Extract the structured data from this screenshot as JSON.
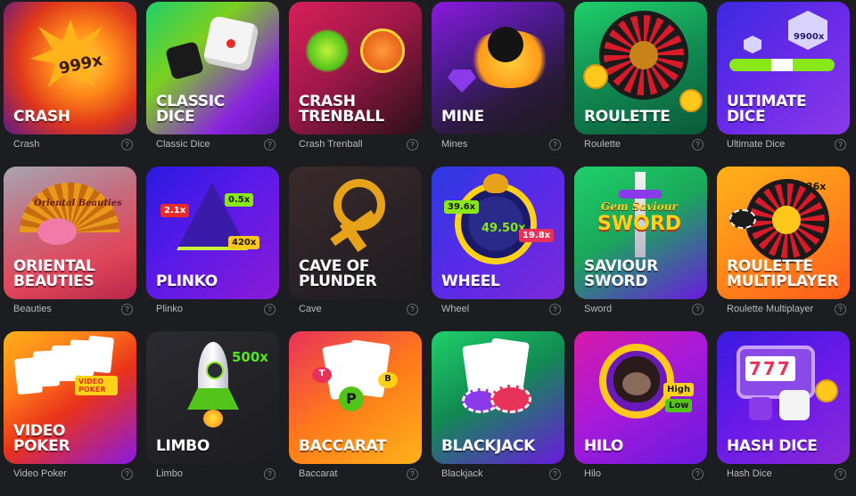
{
  "games": [
    {
      "title": "CRASH",
      "caption": "Crash",
      "badges": [
        "999x"
      ]
    },
    {
      "title": "CLASSIC\nDICE",
      "caption": "Classic Dice",
      "badges": []
    },
    {
      "title": "CRASH\nTRENBALL",
      "caption": "Crash Trenball",
      "badges": []
    },
    {
      "title": "MINE",
      "caption": "Mines",
      "badges": []
    },
    {
      "title": "ROULETTE",
      "caption": "Roulette",
      "badges": []
    },
    {
      "title": "ULTIMATE\nDICE",
      "caption": "Ultimate Dice",
      "badges": [
        "9900x"
      ]
    },
    {
      "title": "ORIENTAL\nBEAUTIES",
      "caption": "Beauties",
      "badges": [
        "Oriental Beauties"
      ]
    },
    {
      "title": "PLINKO",
      "caption": "Plinko",
      "badges": [
        "2.1x",
        "0.5x",
        "420x"
      ]
    },
    {
      "title": "CAVE OF\nPLUNDER",
      "caption": "Cave",
      "badges": []
    },
    {
      "title": "WHEEL",
      "caption": "Wheel",
      "badges": [
        "39.6x",
        "49.50x",
        "19.8x"
      ]
    },
    {
      "title": "SAVIOUR\nSWORD",
      "caption": "Sword",
      "badges": [
        "Gem Saviour",
        "SWORD"
      ]
    },
    {
      "title": "ROULETTE\nMULTIPLAYER",
      "caption": "Roulette Multiplayer",
      "badges": [
        "36x"
      ]
    },
    {
      "title": "VIDEO\nPOKER",
      "caption": "Video Poker",
      "badges": [
        "VIDEO POKER"
      ]
    },
    {
      "title": "LIMBO",
      "caption": "Limbo",
      "badges": [
        "500x"
      ]
    },
    {
      "title": "BACCARAT",
      "caption": "Baccarat",
      "badges": [
        "T",
        "P",
        "B"
      ]
    },
    {
      "title": "BLACKJACK",
      "caption": "Blackjack",
      "badges": []
    },
    {
      "title": "HILO",
      "caption": "Hilo",
      "badges": [
        "High",
        "Low"
      ]
    },
    {
      "title": "HASH DICE",
      "caption": "Hash Dice",
      "badges": [
        "777"
      ]
    }
  ],
  "help_glyph": "?"
}
